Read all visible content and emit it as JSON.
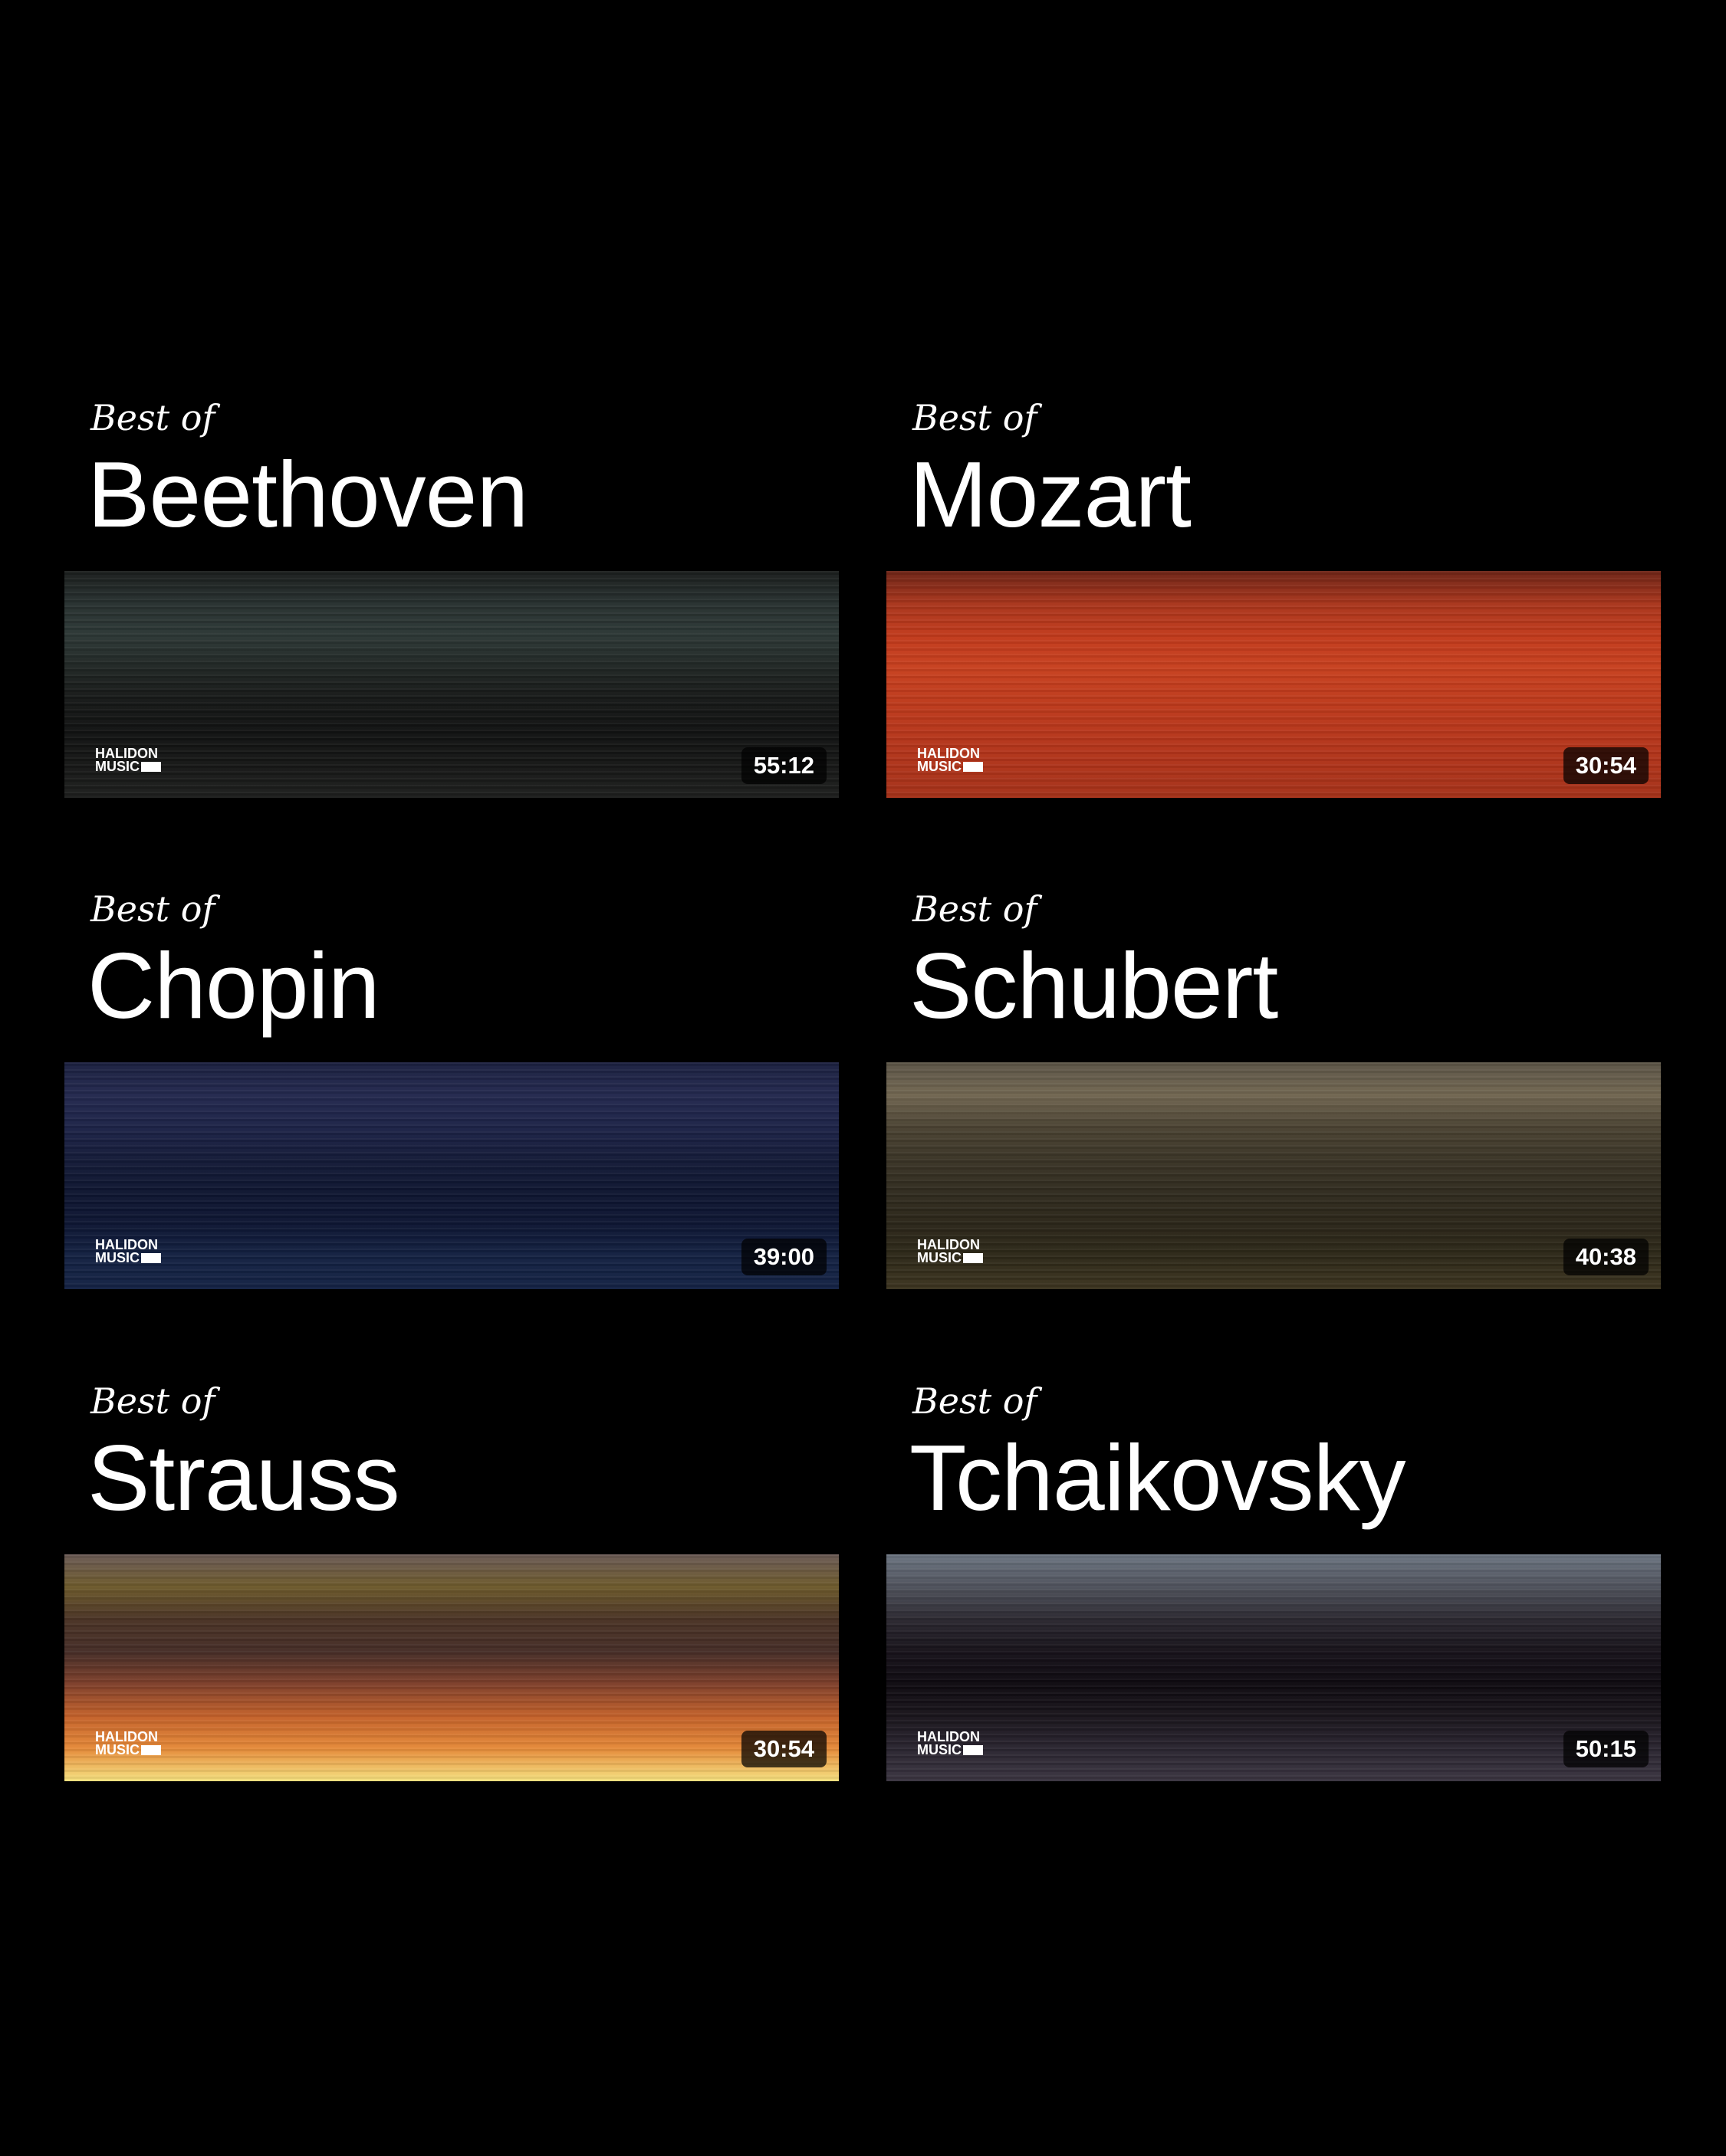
{
  "cards": [
    {
      "prefix": "Best of",
      "composer": "Beethoven",
      "duration": "55:12",
      "logo": {
        "line1": "HALIDON",
        "line2": "MUSIC"
      },
      "colors": [
        "#1b1e1d",
        "#27302f",
        "#2c3735",
        "#202624",
        "#161817",
        "#111212",
        "#161716",
        "#1e1f1e"
      ]
    },
    {
      "prefix": "Best of",
      "composer": "Mozart",
      "duration": "30:54",
      "logo": {
        "line1": "HALIDON",
        "line2": "MUSIC"
      },
      "colors": [
        "#6e2416",
        "#a8351c",
        "#c13a1c",
        "#c7401f",
        "#be3a1c",
        "#b7361b",
        "#ae331a",
        "#a5321a"
      ]
    },
    {
      "prefix": "Best of",
      "composer": "Chopin",
      "duration": "39:00",
      "logo": {
        "line1": "HALIDON",
        "line2": "MUSIC"
      },
      "colors": [
        "#1c2140",
        "#23284e",
        "#1d2347",
        "#141b38",
        "#0e1530",
        "#0e1633",
        "#132141",
        "#142244"
      ]
    },
    {
      "prefix": "Best of",
      "composer": "Schubert",
      "duration": "40:38",
      "logo": {
        "line1": "HALIDON",
        "line2": "MUSIC"
      },
      "colors": [
        "#5b5446",
        "#716651",
        "#4a4232",
        "#3a3426",
        "#302b1f",
        "#2b2619",
        "#2d2818",
        "#3c3420"
      ]
    },
    {
      "prefix": "Best of",
      "composer": "Strauss",
      "duration": "30:54",
      "logo": {
        "line1": "HALIDON",
        "line2": "MUSIC"
      },
      "colors": [
        "#6a5a55",
        "#6d5a2c",
        "#4a3325",
        "#452d27",
        "#7e3f2a",
        "#c3612a",
        "#e58a39",
        "#f5e17f"
      ]
    },
    {
      "prefix": "Best of",
      "composer": "Tchaikovsky",
      "duration": "50:15",
      "logo": {
        "line1": "HALIDON",
        "line2": "MUSIC"
      },
      "colors": [
        "#6b7480",
        "#4f525c",
        "#2b2830",
        "#17121a",
        "#0e0a10",
        "#1a151c",
        "#2a2530",
        "#3a3440"
      ]
    }
  ]
}
